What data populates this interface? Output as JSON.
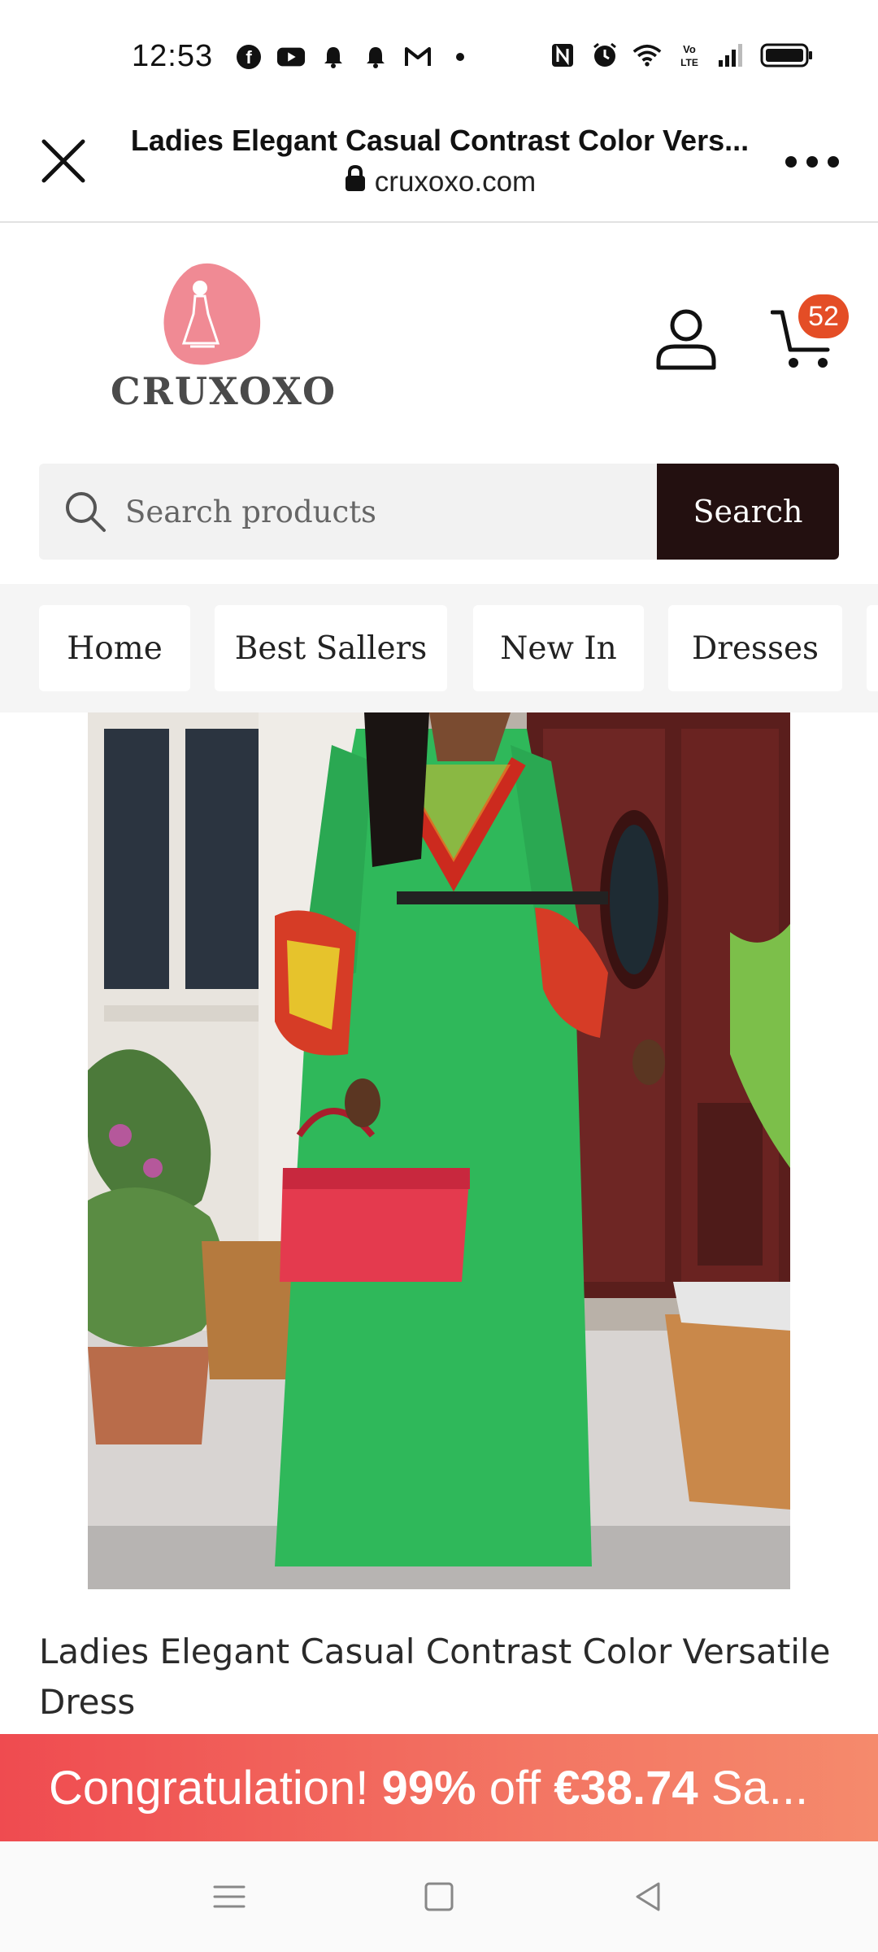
{
  "status_bar": {
    "time": "12:53",
    "left_icons": [
      "facebook-icon",
      "youtube-icon",
      "bell-icon",
      "bell-icon",
      "gmail-icon",
      "dot-icon"
    ],
    "right_icons": [
      "nfc-icon",
      "alarm-icon",
      "wifi-icon",
      "volte-icon",
      "signal-icon",
      "battery-icon"
    ]
  },
  "browser": {
    "title": "Ladies Elegant Casual Contrast Color Vers...",
    "url": "cruxoxo.com"
  },
  "header": {
    "logo_text": "CRUXOXO",
    "cart_count": "52"
  },
  "search": {
    "placeholder": "Search products",
    "button_label": "Search"
  },
  "nav": {
    "items": [
      {
        "label": "Home"
      },
      {
        "label": "Best Sallers"
      },
      {
        "label": "New In"
      },
      {
        "label": "Dresses"
      }
    ]
  },
  "product": {
    "title": "Ladies Elegant Casual Contrast Color Versatile Dress"
  },
  "promo": {
    "prefix": "Congratulation!",
    "discount": "99%",
    "off": "off",
    "price": "€38.74",
    "suffix": "Sa..."
  },
  "colors": {
    "accent": "#231010",
    "badge": "#e44d26",
    "banner_start": "#ef4b50",
    "banner_end": "#f58a6c",
    "logo_pink": "#f08a94"
  }
}
